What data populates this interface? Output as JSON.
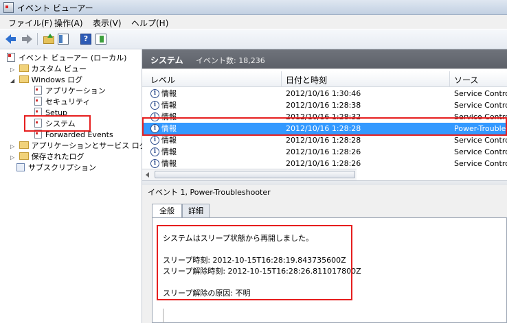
{
  "window": {
    "title": "イベント ビューアー"
  },
  "menu": [
    "ファイル(F)",
    "操作(A)",
    "表示(V)",
    "ヘルプ(H)"
  ],
  "toolbar": {
    "help_label": "?"
  },
  "tree": {
    "root": "イベント ビューアー (ローカル)",
    "custom_views": "カスタム ビュー",
    "windows_logs": "Windows ログ",
    "application": "アプリケーション",
    "security": "セキュリティ",
    "setup": "Setup",
    "system": "システム",
    "forwarded": "Forwarded Events",
    "app_service": "アプリケーションとサービス ログ",
    "saved": "保存されたログ",
    "subscriptions": "サブスクリプション",
    "expand_glyph": "▷",
    "collapse_glyph": "◢"
  },
  "main": {
    "title": "システム",
    "event_count": "イベント数: 18,236",
    "columns": {
      "level": "レベル",
      "datetime": "日付と時刻",
      "source": "ソース"
    },
    "info_glyph": "i",
    "rows": [
      {
        "level": "情報",
        "datetime": "2012/10/16 1:30:46",
        "source": "Service Control"
      },
      {
        "level": "情報",
        "datetime": "2012/10/16 1:28:38",
        "source": "Service Control"
      },
      {
        "level": "情報",
        "datetime": "2012/10/16 1:28:32",
        "source": "Service Control"
      },
      {
        "level": "情報",
        "datetime": "2012/10/16 1:28:28",
        "source": "Power-Troubleshooter"
      },
      {
        "level": "情報",
        "datetime": "2012/10/16 1:28:28",
        "source": "Service Control"
      },
      {
        "level": "情報",
        "datetime": "2012/10/16 1:28:26",
        "source": "Service Control"
      },
      {
        "level": "情報",
        "datetime": "2012/10/16 1:28:26",
        "source": "Service Control"
      }
    ],
    "selected_row": 3
  },
  "detail": {
    "header": "イベント 1, Power-Troubleshooter",
    "tabs": [
      "全般",
      "詳細"
    ],
    "message": "システムはスリープ状態から再開しました。\n\nスリープ時刻: 2012-10-15T16:28:19.843735600Z\nスリープ解除時刻: 2012-10-15T16:28:26.811017800Z\n\nスリープ解除の原因: 不明"
  },
  "colors": {
    "selection": "#3399ff",
    "highlight": "#e61e1e",
    "header_bar": "#5c6068"
  }
}
